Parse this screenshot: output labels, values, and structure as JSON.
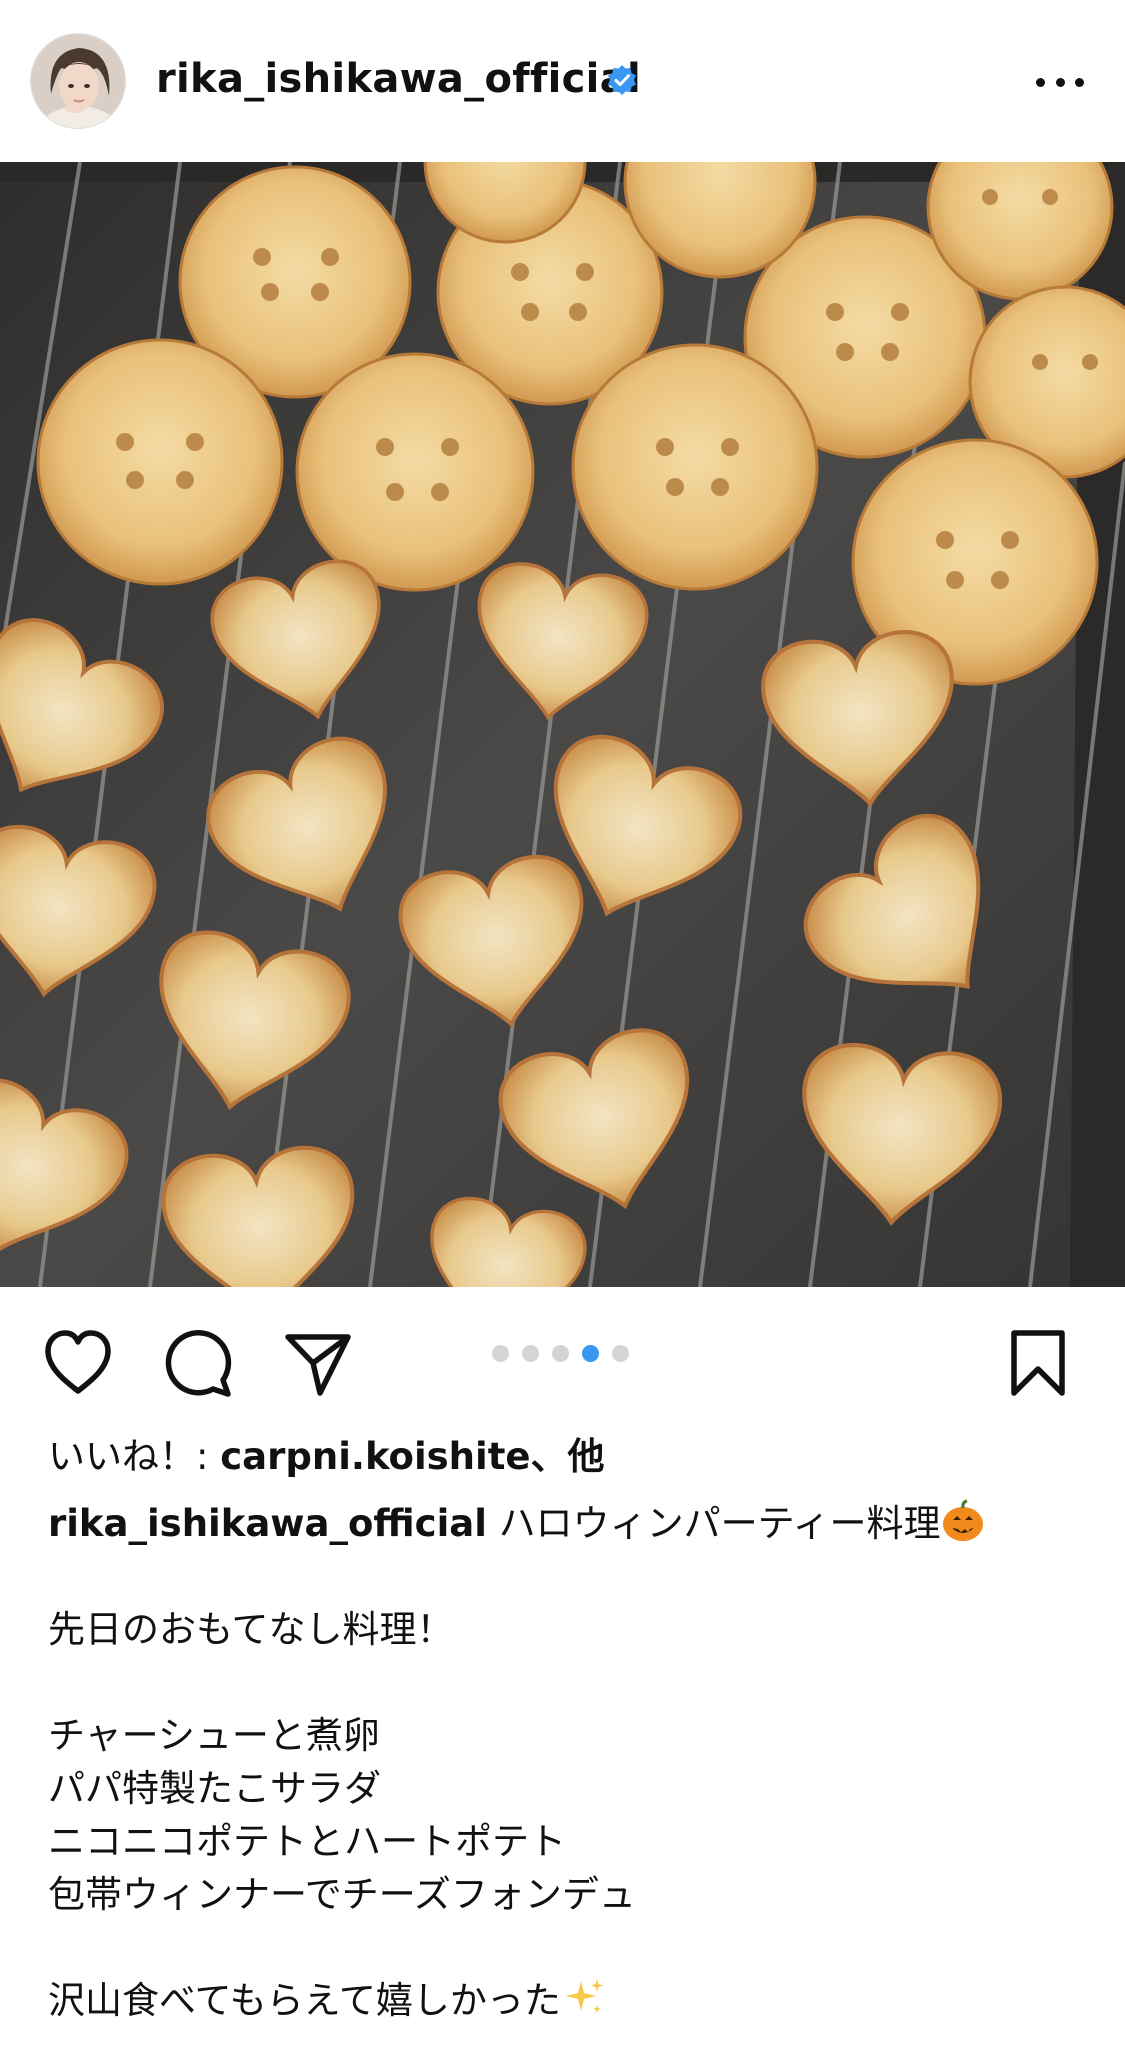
{
  "post": {
    "username": "rika_ishikawa_official",
    "verified": true
  },
  "carousel": {
    "count": 5,
    "active_index": 3
  },
  "likes": {
    "prefix": "いいね！: ",
    "user": "carpni.koishite",
    "suffix": "、他"
  },
  "caption": {
    "username": "rika_ishikawa_official",
    "title": " ハロウィンパーティー料理",
    "title_emoji": "jack-o-lantern",
    "body": "\n\n先日のおもてなし料理！\n\nチャーシューと煮卵\nパパ特製たこサラダ\nニコニコポテトとハートポテト\n包帯ウィンナーでチーズフォンデュ\n\n沢山食べてもらえて嬉しかった",
    "end_emoji": "sparkles"
  },
  "icons": {
    "like": "heart-icon",
    "comment": "comment-icon",
    "share": "paper-plane-icon",
    "save": "bookmark-icon",
    "more": "more-dots-icon",
    "verified": "verified-badge-icon"
  },
  "colors": {
    "verified": "#3897f0",
    "active_dot": "#3897f0",
    "inactive_dot": "#d4d4d4",
    "text": "#111111"
  }
}
